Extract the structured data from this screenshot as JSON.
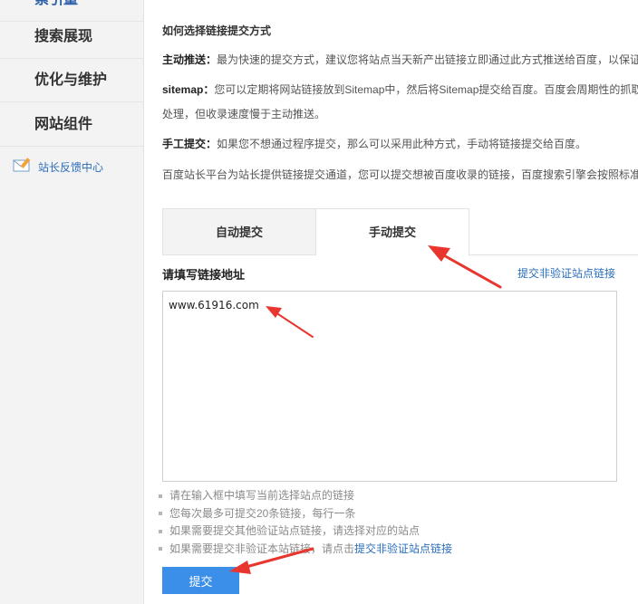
{
  "sidebar": {
    "items": [
      {
        "label": "索引量"
      },
      {
        "label": "搜索展现"
      },
      {
        "label": "优化与维护"
      },
      {
        "label": "网站组件"
      }
    ],
    "feedback": {
      "icon": "mail-edit-icon",
      "label": "站长反馈中心"
    }
  },
  "main": {
    "section_title": "如何选择链接提交方式",
    "paragraphs": {
      "p1_label": "主动推送：",
      "p1_text": "最为快速的提交方式，建议您将站点当天新产出链接立即通过此方式推送给百度，以保证",
      "p2_label": "sitemap：",
      "p2_text": "您可以定期将网站链接放到Sitemap中，然后将Sitemap提交给百度。百度会周期性的抓取",
      "p2_cont": "处理，但收录速度慢于主动推送。",
      "p3_label": "手工提交：",
      "p3_text": "如果您不想通过程序提交，那么可以采用此种方式，手动将链接提交给百度。",
      "p4_text": "百度站长平台为站长提供链接提交通道，您可以提交想被百度收录的链接，百度搜索引擎会按照标准"
    },
    "tabs": [
      {
        "label": "自动提交"
      },
      {
        "label": "手动提交"
      }
    ],
    "field_label": "请填写链接地址",
    "right_link": "提交非验证站点链接",
    "textarea_value": "www.61916.com",
    "tips": [
      {
        "text": "请在输入框中填写当前选择站点的链接"
      },
      {
        "text": "您每次最多可提交20条链接，每行一条"
      },
      {
        "text": "如果需要提交其他验证站点链接，请选择对应的站点"
      },
      {
        "text": "如果需要提交非验证本站链接，请点击",
        "link": "提交非验证站点链接"
      }
    ],
    "submit_label": "提交"
  },
  "colors": {
    "accent_blue": "#3b8fe8",
    "link_blue": "#2a6ebb",
    "annotation_red": "#e8362f",
    "sidebar_bg": "#f3f3f3"
  }
}
